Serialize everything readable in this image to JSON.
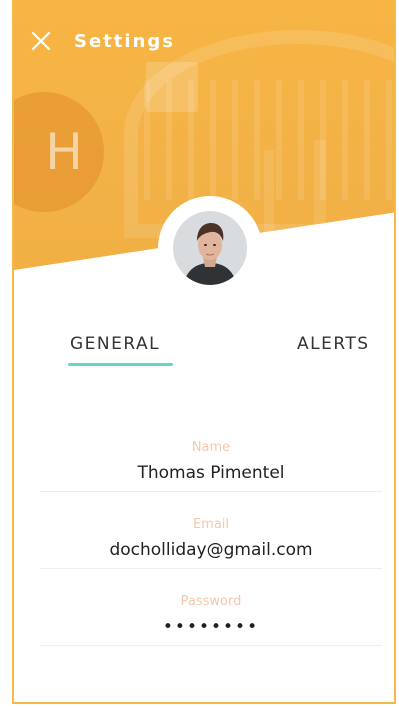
{
  "header": {
    "title": "Settings",
    "close_icon": "close-icon"
  },
  "profile": {
    "avatar": "avatar-photo"
  },
  "tabs": [
    {
      "label": "GENERAL",
      "active": true
    },
    {
      "label": "ALERTS",
      "active": false
    }
  ],
  "form": {
    "name": {
      "label": "Name",
      "value": "Thomas Pimentel"
    },
    "email": {
      "label": "Email",
      "value": "docholliday@gmail.com"
    },
    "password": {
      "label": "Password",
      "value": "••••••••"
    }
  },
  "colors": {
    "accent": "#f7b544",
    "tab_indicator": "#5fd8c9",
    "label": "#f5c7a9"
  }
}
